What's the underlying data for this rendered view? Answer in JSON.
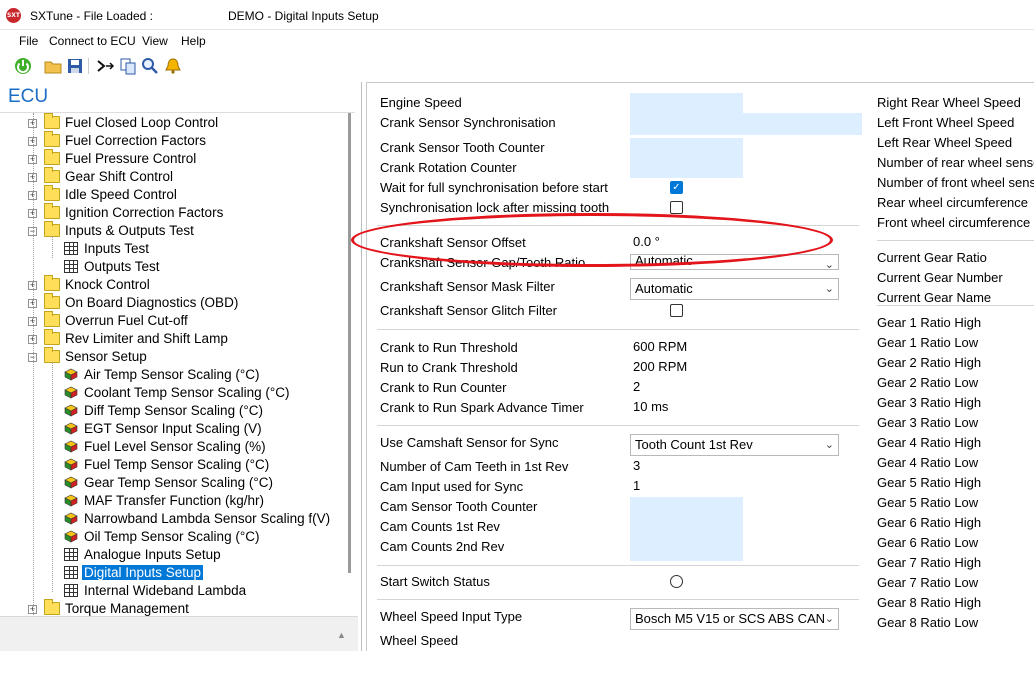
{
  "titlebar": {
    "app_title": "SXTune - File Loaded :",
    "document": "DEMO - Digital Inputs Setup",
    "app_icon_text": "SXT"
  },
  "menu": [
    "File",
    "Connect to ECU",
    "View",
    "Help"
  ],
  "toolbar": [
    "power-icon",
    "open-folder-icon",
    "save-icon",
    "compare-icon",
    "copy-icon",
    "search-icon",
    "alert-icon"
  ],
  "tree": {
    "header": "ECU",
    "items": [
      {
        "label": "Fuel Closed Loop Control",
        "type": "folder",
        "expanded": false
      },
      {
        "label": "Fuel Correction Factors",
        "type": "folder",
        "expanded": false
      },
      {
        "label": "Fuel Pressure Control",
        "type": "folder",
        "expanded": false
      },
      {
        "label": "Gear Shift Control",
        "type": "folder",
        "expanded": false
      },
      {
        "label": "Idle Speed Control",
        "type": "folder",
        "expanded": false
      },
      {
        "label": "Ignition Correction Factors",
        "type": "folder",
        "expanded": false
      },
      {
        "label": "Inputs & Outputs Test",
        "type": "folder",
        "expanded": true
      },
      {
        "label": "Inputs Test",
        "type": "grid",
        "child": true
      },
      {
        "label": "Outputs Test",
        "type": "grid",
        "child": true
      },
      {
        "label": "Knock Control",
        "type": "folder",
        "expanded": false
      },
      {
        "label": "On Board Diagnostics (OBD)",
        "type": "folder",
        "expanded": false
      },
      {
        "label": "Overrun Fuel Cut-off",
        "type": "folder",
        "expanded": false
      },
      {
        "label": "Rev Limiter and Shift Lamp",
        "type": "folder",
        "expanded": false
      },
      {
        "label": "Sensor Setup",
        "type": "folder",
        "expanded": true
      },
      {
        "label": "Air Temp Sensor Scaling (°C)",
        "type": "cube",
        "child": true
      },
      {
        "label": "Coolant Temp Sensor Scaling (°C)",
        "type": "cube",
        "child": true
      },
      {
        "label": "Diff Temp Sensor Scaling (°C)",
        "type": "cube",
        "child": true
      },
      {
        "label": "EGT Sensor Input Scaling (V)",
        "type": "cube",
        "child": true
      },
      {
        "label": "Fuel Level Sensor Scaling (%)",
        "type": "cube",
        "child": true
      },
      {
        "label": "Fuel Temp Sensor Scaling (°C)",
        "type": "cube",
        "child": true
      },
      {
        "label": "Gear Temp Sensor Scaling (°C)",
        "type": "cube",
        "child": true
      },
      {
        "label": "MAF Transfer Function (kg/hr)",
        "type": "cube",
        "child": true
      },
      {
        "label": "Narrowband Lambda Sensor Scaling f(V)",
        "type": "cube",
        "child": true
      },
      {
        "label": "Oil Temp Sensor Scaling (°C)",
        "type": "cube",
        "child": true
      },
      {
        "label": "Analogue Inputs Setup",
        "type": "grid",
        "child": true
      },
      {
        "label": "Digital Inputs Setup",
        "type": "grid",
        "child": true,
        "selected": true
      },
      {
        "label": "Internal Wideband Lambda",
        "type": "grid",
        "child": true
      },
      {
        "label": "Torque Management",
        "type": "folder",
        "expanded": false
      }
    ]
  },
  "main": {
    "rows": [
      {
        "label": "Engine Speed"
      },
      {
        "label": "Crank Sensor Synchronisation"
      },
      {
        "label": "Crank Sensor Tooth Counter"
      },
      {
        "label": "Crank Rotation Counter"
      },
      {
        "label": "Wait for full synchronisation before start"
      },
      {
        "label": "Synchronisation lock after missing tooth"
      },
      {
        "label": "Crankshaft Sensor Offset",
        "value": "0.0 °"
      },
      {
        "label": "Crankshaft Sensor Gap/Tooth Ratio",
        "value": "Automatic"
      },
      {
        "label": "Crankshaft Sensor Mask Filter",
        "value": "Automatic"
      },
      {
        "label": "Crankshaft Sensor Glitch Filter"
      },
      {
        "label": "Crank to Run Threshold",
        "value": "600 RPM"
      },
      {
        "label": "Run to Crank Threshold",
        "value": "200 RPM"
      },
      {
        "label": "Crank to Run Counter",
        "value": "2"
      },
      {
        "label": "Crank to Run Spark Advance Timer",
        "value": "10 ms"
      },
      {
        "label": "Use Camshaft Sensor for Sync",
        "value": "Tooth Count 1st Rev"
      },
      {
        "label": "Number of Cam Teeth in 1st Rev",
        "value": "3"
      },
      {
        "label": "Cam Input used for Sync",
        "value": "1"
      },
      {
        "label": "Cam Sensor Tooth Counter"
      },
      {
        "label": "Cam Counts 1st Rev"
      },
      {
        "label": "Cam Counts 2nd Rev"
      },
      {
        "label": "Start Switch Status"
      },
      {
        "label": "Wheel Speed Input Type",
        "value": "Bosch M5 V15 or SCS ABS CAN"
      },
      {
        "label": "Wheel Speed"
      }
    ],
    "checkboxes": {
      "wait_full_sync": true,
      "sync_lock": false,
      "glitch_filter": false
    },
    "right_col": [
      "Right Rear Wheel Speed",
      "Left Front Wheel Speed",
      "Left Rear Wheel Speed",
      "Number of rear wheel sensors",
      "Number of front wheel sensors",
      "Rear wheel circumference",
      "Front wheel circumference",
      "Current Gear Ratio",
      "Current Gear Number",
      "Current Gear Name",
      "Gear 1 Ratio High",
      "Gear 1 Ratio Low",
      "Gear 2 Ratio High",
      "Gear 2 Ratio Low",
      "Gear 3 Ratio High",
      "Gear 3 Ratio Low",
      "Gear 4 Ratio High",
      "Gear 4 Ratio Low",
      "Gear 5 Ratio High",
      "Gear 5 Ratio Low",
      "Gear 6 Ratio High",
      "Gear 6 Ratio Low",
      "Gear 7 Ratio High",
      "Gear 7 Ratio Low",
      "Gear 8 Ratio High",
      "Gear 8 Ratio Low"
    ]
  },
  "colors": {
    "accent": "#0078d7",
    "readonly_field": "#dceeff",
    "annotation": "#e3141a",
    "ecu_header": "#1a6fc4"
  }
}
